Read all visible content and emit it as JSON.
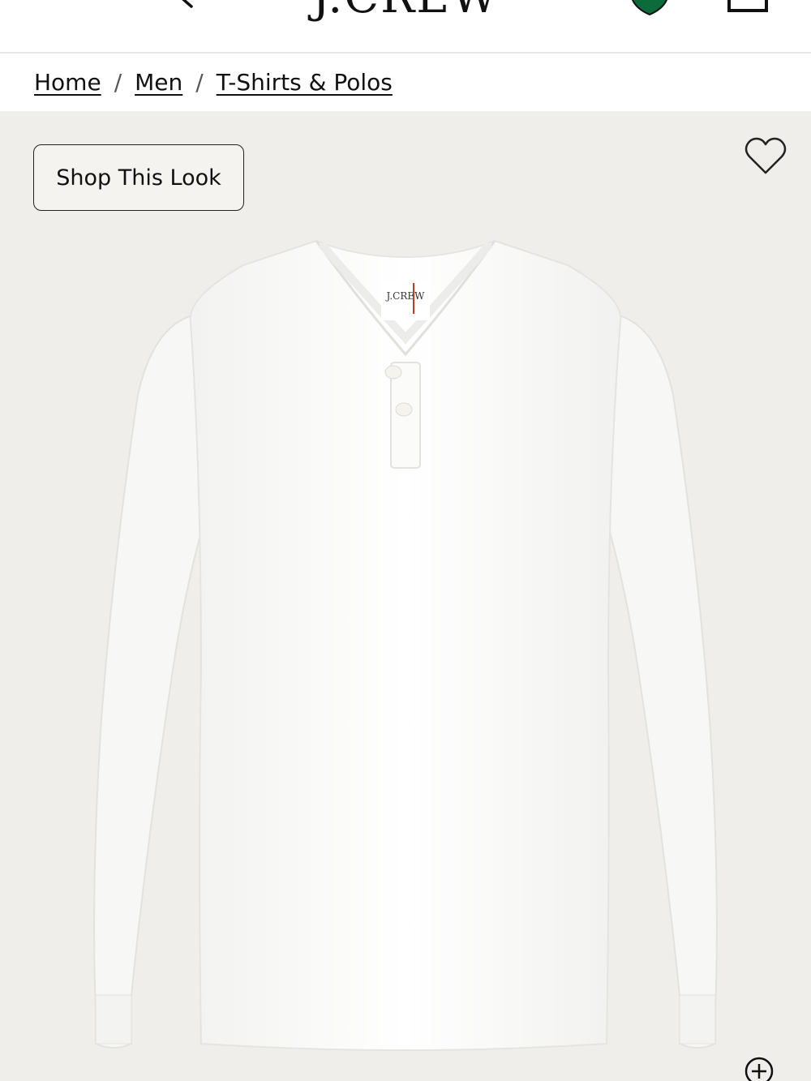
{
  "header": {
    "logo_text": "J.CREW",
    "icons": [
      "menu-icon",
      "search-icon",
      "rewards-badge-icon",
      "shopping-bag-icon"
    ]
  },
  "breadcrumb": {
    "items": [
      "Home",
      "Men",
      "T-Shirts & Polos"
    ],
    "separator": "/"
  },
  "gallery": {
    "shop_this_look_label": "Shop This Look",
    "icons": [
      "heart-icon",
      "zoom-plus-icon"
    ],
    "background_color": "#efeeeb"
  },
  "colors": {
    "badge_green": "#0b6b3a",
    "text": "#111111"
  }
}
